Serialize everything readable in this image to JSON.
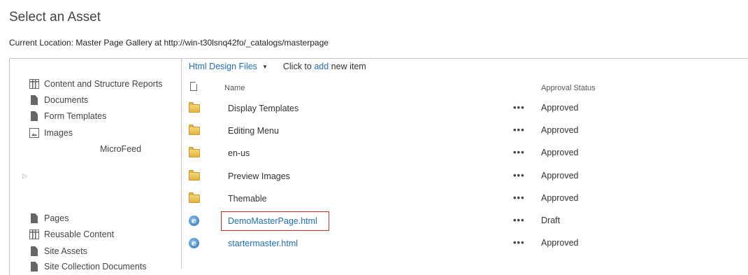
{
  "page": {
    "title": "Select an Asset",
    "location": "Current Location: Master Page Gallery at http://win-t30lsnq42fo/_catalogs/masterpage"
  },
  "nav": {
    "items_top": [
      {
        "label": "Content and Structure Reports",
        "icon": "table-icon"
      },
      {
        "label": "Documents",
        "icon": "document-icon"
      },
      {
        "label": "Form Templates",
        "icon": "document-icon"
      },
      {
        "label": "Images",
        "icon": "image-icon"
      }
    ],
    "microfeed": "MicroFeed",
    "items_bottom": [
      {
        "label": "Pages",
        "icon": "document-icon"
      },
      {
        "label": "Reusable Content",
        "icon": "table-icon"
      },
      {
        "label": "Site Assets",
        "icon": "document-icon"
      },
      {
        "label": "Site Collection Documents",
        "icon": "document-icon"
      }
    ]
  },
  "toolbar": {
    "view_label": "Html Design Files",
    "click_prefix": "Click to",
    "add_label": "add",
    "click_suffix": "new item"
  },
  "table": {
    "col_name": "Name",
    "col_status": "Approval Status",
    "rows": [
      {
        "name": "Display Templates",
        "type": "folder",
        "dots": "•••",
        "status": "Approved"
      },
      {
        "name": "Editing Menu",
        "type": "folder",
        "dots": "•••",
        "status": "Approved"
      },
      {
        "name": "en-us",
        "type": "folder",
        "dots": "•••",
        "status": "Approved"
      },
      {
        "name": "Preview Images",
        "type": "folder",
        "dots": "•••",
        "status": "Approved"
      },
      {
        "name": "Themable",
        "type": "folder",
        "dots": "•••",
        "status": "Approved"
      },
      {
        "name": "DemoMasterPage.html",
        "type": "html",
        "dots": "•••",
        "status": "Draft"
      },
      {
        "name": "startermaster.html",
        "type": "html",
        "dots": "•••",
        "status": "Approved"
      }
    ]
  },
  "colors": {
    "link": "#1e6fb4",
    "highlight": "#d12e2e"
  }
}
